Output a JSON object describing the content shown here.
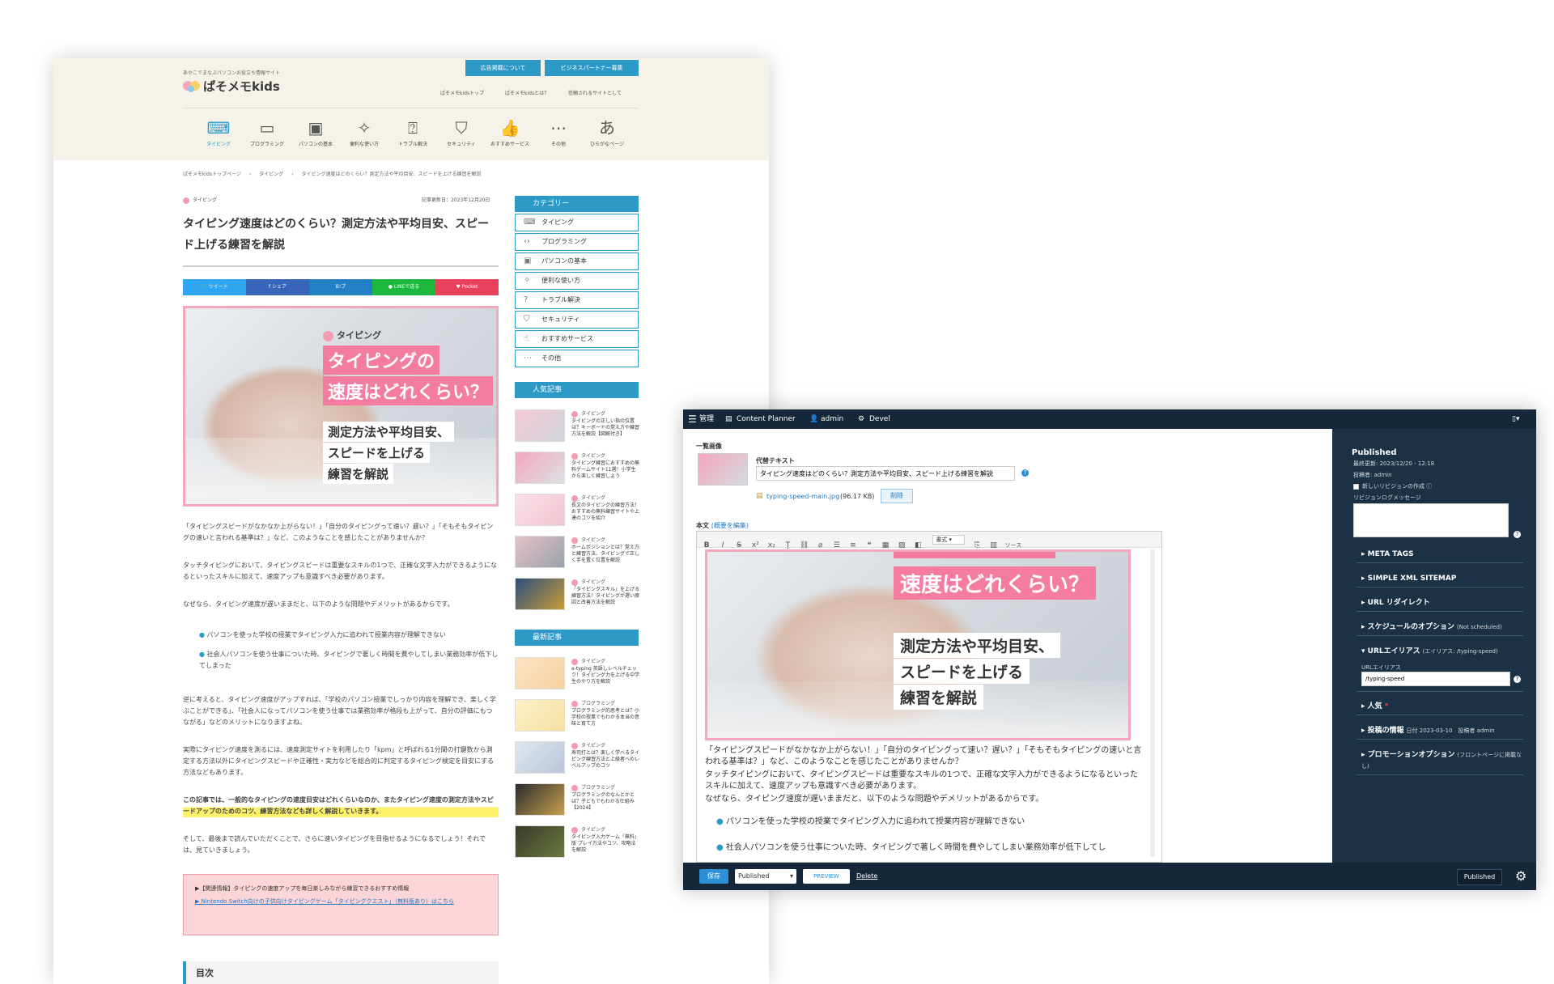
{
  "blog": {
    "tagline": "あやこでまなぶパソコンお役立ち情報サイト",
    "logo": "ぱそメモkids",
    "top_buttons": [
      "広告掲載について",
      "ビジネスパートナー募集"
    ],
    "top_links": [
      "ぱそメモkidsトップ",
      "ぱそメモkidsとは？",
      "信頼されるサイトとして"
    ],
    "nav": [
      {
        "label": "タイピング",
        "icon": "keyboard-icon"
      },
      {
        "label": "プログラミング",
        "icon": "code-icon"
      },
      {
        "label": "パソコンの基本",
        "icon": "monitor-icon"
      },
      {
        "label": "便利な使い方",
        "icon": "magic-icon"
      },
      {
        "label": "トラブル解決",
        "icon": "question-icon"
      },
      {
        "label": "セキュリティ",
        "icon": "shield-icon"
      },
      {
        "label": "おすすめサービス",
        "icon": "thumbs-up-icon"
      },
      {
        "label": "その他",
        "icon": "ellipsis-icon"
      },
      {
        "label": "ひらがなページ",
        "icon": "hiragana-icon"
      }
    ],
    "breadcrumb": [
      "ぱそメモkidsトップページ",
      "タイピング",
      "タイピング速度はどのくらい？測定方法や平均目安、スピードを上げる練習を解説"
    ],
    "category": "タイピング",
    "updated": "記事更新日：2023年12月20日",
    "title": "タイピング速度はどのくらい？測定方法や平均目安、スピード上げる練習を解説",
    "share": [
      "ツイート",
      "シェア",
      "B!ブ",
      "LINEで送る",
      "Pocket"
    ],
    "hero": {
      "tag": "タイピング",
      "line1": "タイピングの",
      "line2": "速度はどれくらい？",
      "line3": "測定方法や平均目安、",
      "line4": "スピードを上げる",
      "line5": "練習を解説"
    },
    "paragraphs": [
      "「タイピングスピードがなかなか上がらない！」「自分のタイピングって速い？遅い？」「そもそもタイピングの速いと言われる基準は？」など、このようなことを感じたことがありませんか？",
      "タッチタイピングにおいて、タイピングスピードは重要なスキルの1つで、正確な文字入力ができるようになるといったスキルに加えて、速度アップも意識すべき必要があります。",
      "なぜなら、タイピング速度が遅いままだと、以下のような問題やデメリットがあるからです。"
    ],
    "bullets": [
      "パソコンを使った学校の授業でタイピング入力に追われて授業内容が理解できない",
      "社会人パソコンを使う仕事についた時、タイピングで著しく時間を費やしてしまい業務効率が低下してしまった"
    ],
    "para2": "逆に考えると、タイピング速度がアップすれば、「学校のパソコン授業でしっかり内容を理解でき、楽しく学ぶことができる」、「社会人になってパソコンを使う仕事では業務効率が格段も上がって、自分の評価にもつながる」などのメリットになりますよね。",
    "para3": "実際にタイピング速度を測るには、速度測定サイトを利用したり「kpm」と呼ばれる1分間の打鍵数から測定する方法以外にタイピングスピードや正確性・実力などを総合的に判定するタイピング検定を目安にする方法などもあります。",
    "highlight": "この記事では、一般的なタイピングの速度目安はどれくらいなのか、またタイピング速度の測定方法やスピードアップのためのコツ、練習方法なども詳しく解説していきます。",
    "para4": "そして、最後まで読んでいただくことで、さらに速いタイピングを目指せるようになるでしょう！それでは、見ていきましょう。",
    "info_box": {
      "title": "▶【関連情報】タイピングの速度アップを毎日楽しみながら練習できるおすすめ情報",
      "link": "▶ Nintendo Switch向けの子供向けタイピングゲーム「タイピングクエスト」（無料版あり）はこちら"
    },
    "toc": "目次",
    "sidebar": {
      "category_title": "カテゴリー",
      "categories": [
        "タイピング",
        "プログラミング",
        "パソコンの基本",
        "便利な使い方",
        "トラブル解決",
        "セキュリティ",
        "おすすめサービス",
        "その他"
      ],
      "popular_title": "人気記事",
      "popular": [
        {
          "cat": "タイピング",
          "title": "タイピングの正しい指の位置は？キーボードの覚え方や練習方法を解説【図解付き】"
        },
        {
          "cat": "タイピング",
          "title": "タイピング練習におすすめの無料ゲームサイト11選！小学生から楽しく練習しよう"
        },
        {
          "cat": "タイピング",
          "title": "長文のタイピングの練習方法！おすすめの無料練習サイトや上達のコツを紹介"
        },
        {
          "cat": "タイピング",
          "title": "ホームポジションとは？覚え方と練習方法、タイピングで正しく手を置く位置を解説"
        },
        {
          "cat": "タイピング",
          "title": "「タイピングスキル」を上げる練習方法！タイピングが遅い原因と改善方法を解説"
        }
      ],
      "latest_title": "最新記事",
      "latest": [
        {
          "cat": "タイピング",
          "title": "e-typing 英語しレベルチェック！タイピング力を上げる中学生のやり方を解説"
        },
        {
          "cat": "プログラミング",
          "title": "プログラミング的思考とは？小学校の授業でもわかる本当の意味と育て方"
        },
        {
          "cat": "タイピング",
          "title": "寿司打とは？楽しく学べるタイピング練習方法と上級者へのレベルアップのコツ"
        },
        {
          "cat": "プログラミング",
          "title": "プログラミングのなんとかとは？子どもでもわかる仕組み【2024】"
        },
        {
          "cat": "タイピング",
          "title": "タイピング入力ゲーム「無料」版 プレイ方法やコツ、攻略法を解説"
        }
      ]
    }
  },
  "cms": {
    "toolbar": {
      "manage": "管理",
      "planner": "Content Planner",
      "user": "admin",
      "devel": "Devel"
    },
    "image_label": "一覧画像",
    "alt_label": "代替テキスト",
    "alt_value": "タイピング速度はどのくらい？測定方法や平均目安、スピード上げる練習を解説",
    "file_name": "typing-speed-main.jpg",
    "file_size": "(96.17 KB)",
    "delete_btn": "削除",
    "body_label": "本文",
    "body_edit": "(概要を編集)",
    "editor_format": "書式",
    "editor_source": "ソース",
    "hero_line1": "速度はどれくらい？",
    "hero_line2": "測定方法や平均目安、",
    "hero_line3": "スピードを上げる",
    "hero_line4": "練習を解説",
    "body_p1": "「タイピングスピードがなかなか上がらない！」「自分のタイピングって速い？遅い？」「そもそもタイピングの速いと言われる基準は？」など、このようなことを感じたことがありませんか？",
    "body_p2": "タッチタイピングにおいて、タイピングスピードは重要なスキルの1つで、正確な文字入力ができるようになるといったスキルに加えて、速度アップも意識すべき必要があります。",
    "body_p3": "なぜなら、タイピング速度が遅いままだと、以下のような問題やデメリットがあるからです。",
    "body_b1": "パソコンを使った学校の授業でタイピング入力に追われて授業内容が理解できない",
    "body_b2": "社会人パソコンを使う仕事についた時、タイピングで著しく時間を費やしてしまい業務効率が低下してし",
    "side": {
      "status": "Published",
      "updated": "最終更新: 2023/12/20 - 12:18",
      "author": "投稿者: admin",
      "revision": "新しいリビジョンの作成",
      "revision_msg": "リビジョンログメッセージ",
      "meta": "▸ META TAGS",
      "sitemap": "▸ SIMPLE XML SITEMAP",
      "redirect": "▸ URL リダイレクト",
      "schedule": "▸ スケジュールのオプション",
      "schedule_note": "(Not scheduled)",
      "alias": "▾ URLエイリアス",
      "alias_note": "(エイリアス: /typing-speed)",
      "alias_label": "URLエイリアス",
      "alias_value": "/typing-speed",
      "popular": "▸ 人気",
      "post_info": "▸ 投稿の情報",
      "post_info_note": "日付 2023-03-10　投稿者 admin",
      "promo": "▸ プロモーションオプション",
      "promo_note": "(フロントページに掲載なし)"
    },
    "footer": {
      "save": "保存",
      "status": "Published",
      "preview": "PREVIEW",
      "delete": "Delete",
      "published_btn": "Published"
    }
  }
}
